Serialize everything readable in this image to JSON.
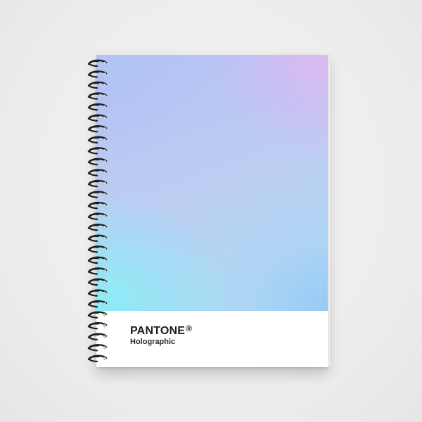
{
  "product": {
    "brand": "PANTONE",
    "registered_mark": "®",
    "color_name": "Holographic"
  },
  "colors": {
    "background": "#eeeeee",
    "paper": "#ffffff",
    "swatch_top_right": "#e2b8f0",
    "swatch_top_left": "#b0c4f6",
    "swatch_bottom_left": "#8aeef6",
    "swatch_bottom_right": "#96c8f6",
    "wire": "#1e1e1e"
  },
  "spiral": {
    "loop_count": 28
  }
}
